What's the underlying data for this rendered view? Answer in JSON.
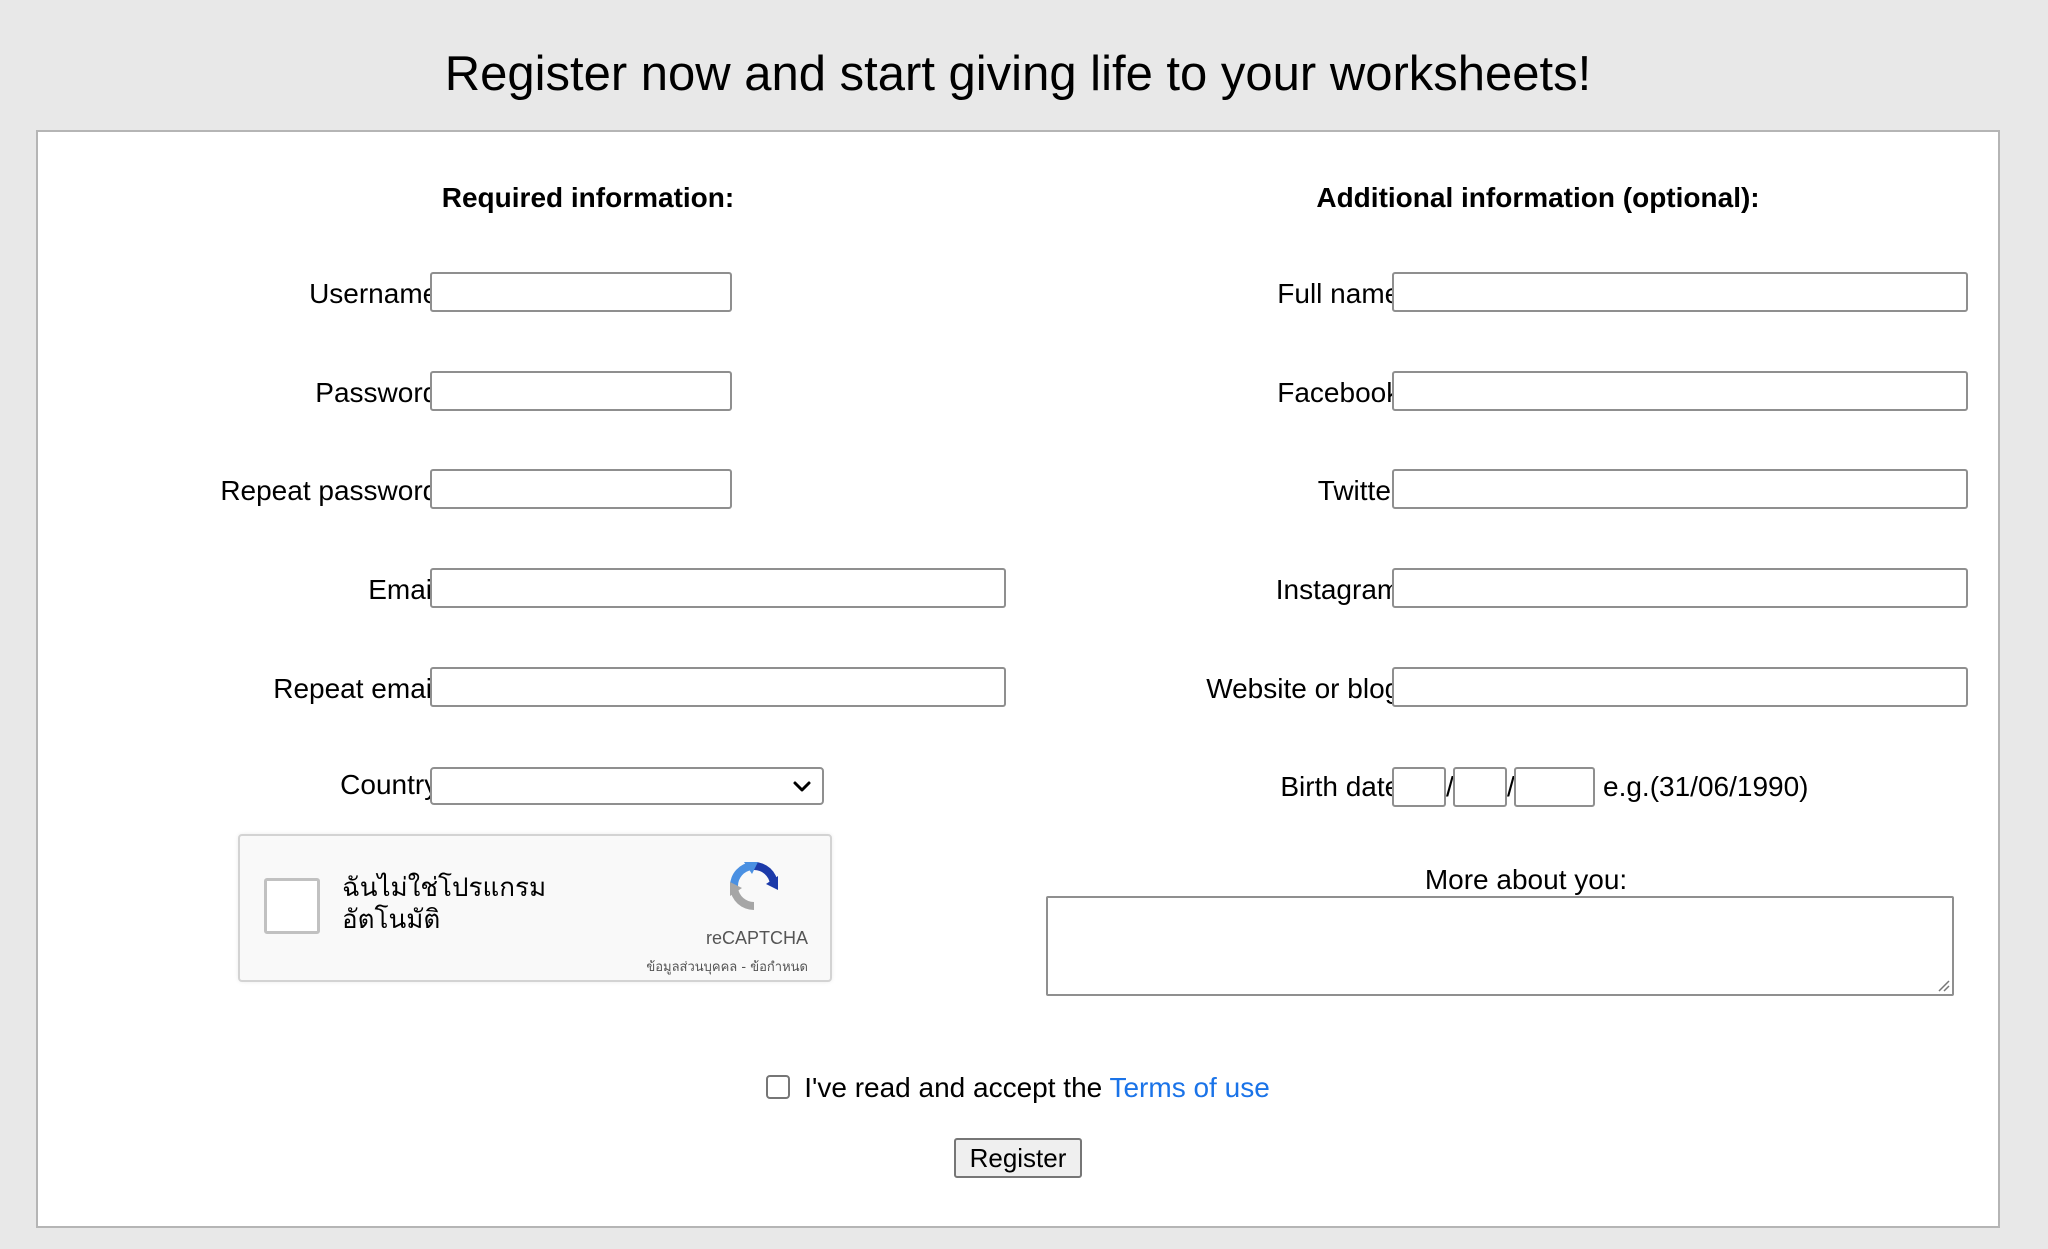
{
  "page": {
    "title": "Register now and start giving life to your worksheets!"
  },
  "required": {
    "heading": "Required information:",
    "username_label": "Username:",
    "password_label": "Password:",
    "repeat_password_label": "Repeat password:",
    "email_label": "Email:",
    "repeat_email_label": "Repeat email:",
    "country_label": "Country:",
    "country_value": ""
  },
  "recaptcha": {
    "checkbox_text": "ฉันไม่ใช่โปรแกรมอัตโนมัติ",
    "line1": "ฉันไม่ใช่โปรแกรม",
    "line2": "อัตโนมัติ",
    "brand": "reCAPTCHA",
    "links": "ข้อมูลส่วนบุคคล - ข้อกำหนด"
  },
  "optional": {
    "heading": "Additional information (optional):",
    "full_name_label": "Full name:",
    "facebook_label": "Facebook:",
    "twitter_label": "Twitter:",
    "instagram_label": "Instagram:",
    "website_label": "Website or blog:",
    "birth_date_label": "Birth date:",
    "birth_date_separator": "/",
    "birth_date_hint": "e.g.(31/06/1990)",
    "more_about_label": "More about you:"
  },
  "terms": {
    "text": "I've read and accept the ",
    "link": "Terms of use"
  },
  "register_button": "Register",
  "colors": {
    "background": "#e8e8e8",
    "panel": "#ffffff",
    "link": "#1a73e8",
    "recaptcha_blue": "#4a90e2",
    "recaptcha_dark_blue": "#1c3aa9",
    "recaptcha_gray": "#a6a6a6"
  }
}
